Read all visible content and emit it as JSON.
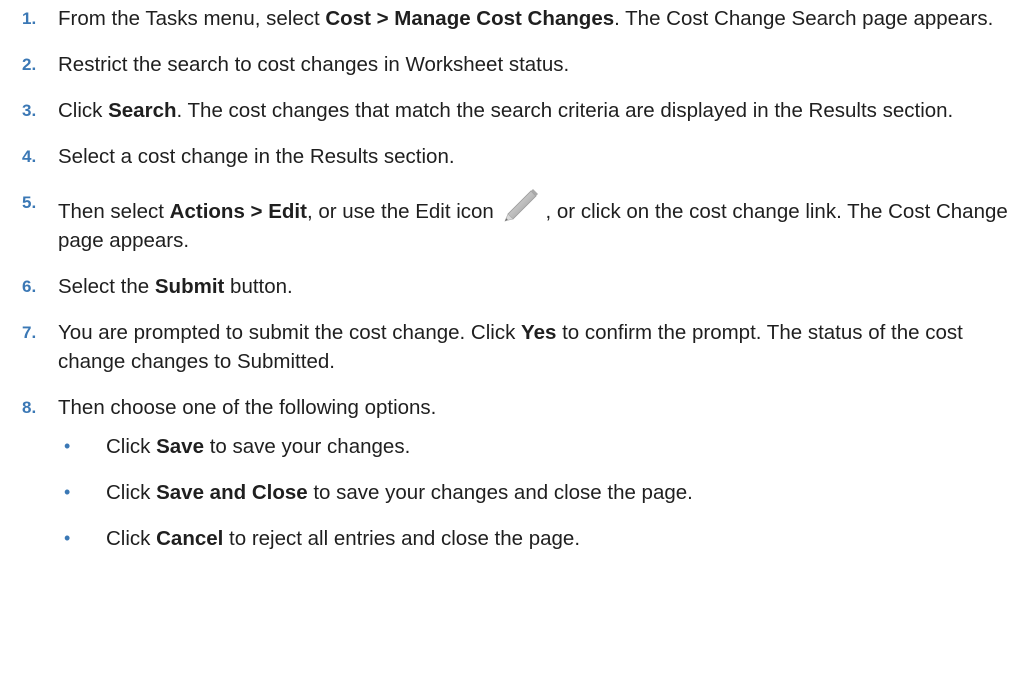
{
  "steps": [
    {
      "num": "1.",
      "parts": [
        "From the Tasks menu, select ",
        "Cost > Manage Cost Changes",
        ". The Cost Change Search page appears."
      ]
    },
    {
      "num": "2.",
      "parts": [
        "Restrict the search to cost changes in Worksheet status."
      ]
    },
    {
      "num": "3.",
      "parts": [
        "Click ",
        "Search",
        ". The cost changes that match the search criteria are displayed in the Results section."
      ]
    },
    {
      "num": "4.",
      "parts": [
        "Select a cost change in the Results section."
      ]
    },
    {
      "num": "5.",
      "parts": [
        "Then select ",
        "Actions > Edit",
        ", or use the Edit icon ",
        ", or click on the cost change link. The Cost Change page appears."
      ]
    },
    {
      "num": "6.",
      "parts": [
        "Select the ",
        "Submit",
        " button."
      ]
    },
    {
      "num": "7.",
      "parts": [
        "You are prompted to submit the cost change. Click ",
        "Yes",
        " to confirm the prompt. The status of the cost change changes to Submitted."
      ]
    },
    {
      "num": "8.",
      "parts": [
        "Then choose one of the following options."
      ]
    }
  ],
  "options": [
    {
      "bullet": "•",
      "parts": [
        "Click ",
        "Save",
        " to save your changes."
      ]
    },
    {
      "bullet": "•",
      "parts": [
        "Click ",
        "Save and Close",
        " to save your changes and close the page."
      ]
    },
    {
      "bullet": "•",
      "parts": [
        "Click ",
        "Cancel",
        " to reject all entries and close the page."
      ]
    }
  ],
  "icons": {
    "edit": "pencil-icon"
  },
  "colors": {
    "step_number": "#3b78b5",
    "text": "#1f1f1f"
  }
}
